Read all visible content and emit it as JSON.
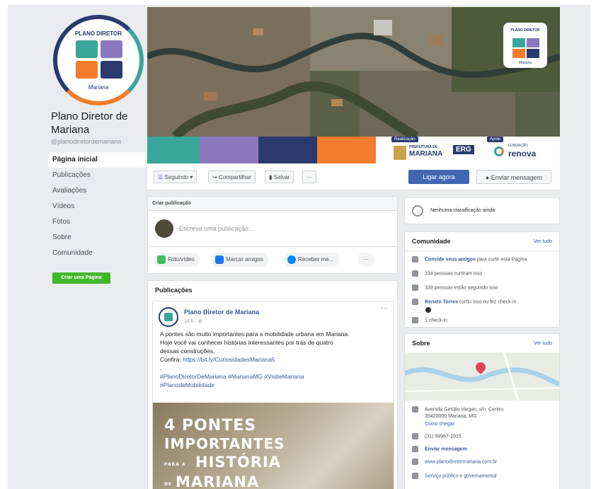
{
  "page": {
    "name": "Plano Diretor de Mariana",
    "handle": "@planodiretordemariana",
    "logo_top": "PLANO DIRETOR",
    "logo_bottom": "Mariana"
  },
  "nav": [
    "Página inicial",
    "Publicações",
    "Avaliações",
    "Vídeos",
    "Fotos",
    "Sobre",
    "Comunidade"
  ],
  "create_page_button": "Criar uma Página",
  "cover": {
    "realizacao": "Realização",
    "apoio": "Apoio",
    "sponsor_prefeitura_top": "PREFEITURA DE",
    "sponsor_prefeitura_bottom": "MARIANA",
    "sponsor_erg": "ERG",
    "sponsor_fundacao": "FUNDAÇÃO",
    "sponsor_renova": "renova",
    "logo_text": "PLANO DIRETOR",
    "logo_sub": "Mariana"
  },
  "actions": {
    "following": "Seguindo",
    "share": "Compartilhar",
    "save": "Salvar",
    "more": "···",
    "call": "Ligar agora",
    "message": "Enviar mensagem"
  },
  "create_post": {
    "header": "Criar publicação",
    "placeholder": "Escreva uma publicação...",
    "photo": "Foto/vídeo",
    "tag": "Marcar amigos",
    "receive": "Receber me...",
    "more": "···"
  },
  "posts_header": "Publicações",
  "post": {
    "author": "Plano Diretor de Mariana",
    "time": "16 h · ",
    "line1": "A pontes são muito importantes para a mobilidade urbana em Mariana.",
    "line2": "Hoje você vai conhecer histórias interessantes por trás de quatro",
    "line3": "dessas construções.",
    "confira": "Confira: ",
    "link": "https://bit.ly/CuriosidadesMariana5",
    "hashtags1": "#PlanoDiretorDeMariana #MarianaMG #VisiteMariana",
    "hashtags2": "#PlanodeMobilidade",
    "more": "···",
    "img_l1": "4 PONTES",
    "img_l2": "IMPORTANTES",
    "img_para": "PARA A",
    "img_l3": "HISTÓRIA",
    "img_de": "DE",
    "img_l4": "MARIANA"
  },
  "ratings": "Nenhuma classificação ainda",
  "community": {
    "title": "Comunidade",
    "see_all": "Ver tudo",
    "invite_link": "Convide seus amigos",
    "invite_rest": " para curtir esta Página",
    "likes": "334 pessoas curtiram isso",
    "follows": "339 pessoas estão seguindo isso",
    "checkin_name": "Renato Torres",
    "checkin_rest": " curtiu isso ou fez check-in",
    "checkins": "1 check-in"
  },
  "about": {
    "title": "Sobre",
    "see_all": "Ver tudo",
    "address1": "Avenida Getúlio Vargas, s/n, Centro",
    "address2": "35420000 Mariana, MG",
    "directions": "Como chegar",
    "phone": "(31) 99967-1915",
    "send_message": "Enviar mensagem",
    "website": "www.planodiretormariana.com.br",
    "category": "Serviço público e governamental"
  },
  "colors": {
    "teal": "#3aa59a",
    "purple": "#8a79bf",
    "navy": "#2a3a6e",
    "orange": "#f07c2c",
    "fb_blue": "#4267b2",
    "green": "#42b72a"
  }
}
